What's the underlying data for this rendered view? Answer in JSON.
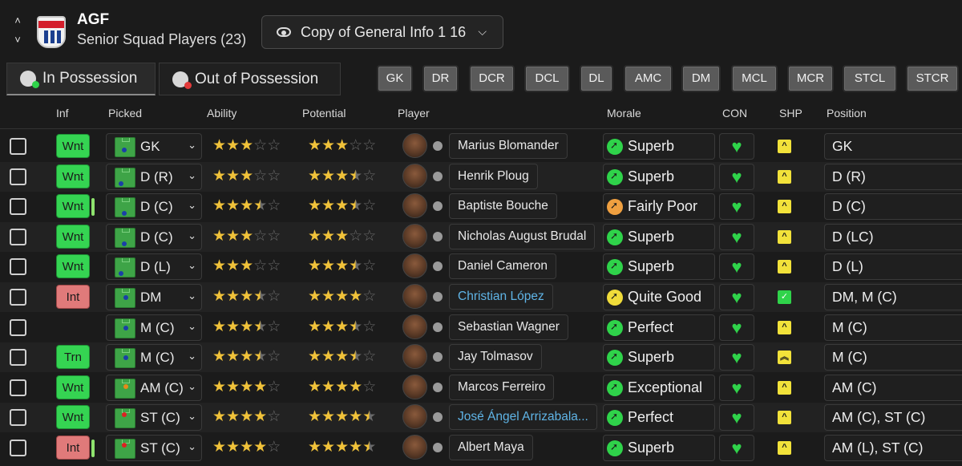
{
  "header": {
    "club": "AGF",
    "squad_title": "Senior Squad Players (23)",
    "view_selector": "Copy of General Info 1 16"
  },
  "tabs": [
    {
      "label": "In Possession",
      "icon": "possession-ball-icon",
      "active": true
    },
    {
      "label": "Out of Possession",
      "icon": "out-of-possession-ball-icon",
      "active": false
    }
  ],
  "position_filters": [
    "GK",
    "DR",
    "DCR",
    "DCL",
    "DL",
    "AMC",
    "DM",
    "MCL",
    "MCR",
    "STCL",
    "STCR"
  ],
  "columns": {
    "inf": "Inf",
    "picked": "Picked",
    "ability": "Ability",
    "potential": "Potential",
    "player": "Player",
    "morale": "Morale",
    "con": "CON",
    "shp": "SHP",
    "position": "Position"
  },
  "colors": {
    "wanted": "#35d452",
    "interested": "#e07a7a",
    "star": "#f0c23a",
    "morale_good": "#2fd34a",
    "morale_poor": "#f0a040",
    "morale_ok": "#f0dc3a",
    "sharpness": "#f2e23a"
  },
  "rows": [
    {
      "inf": "Wnt",
      "picked": "GK",
      "ability": 3,
      "potential": 3,
      "player": "Marius Blomander",
      "morale": "Superb",
      "morale_level": "good",
      "position": "GK",
      "shp": "arrow-up"
    },
    {
      "inf": "Wnt",
      "picked": "D (R)",
      "ability": 3,
      "potential": 3.5,
      "player": "Henrik Ploug",
      "morale": "Superb",
      "morale_level": "good",
      "position": "D (R)",
      "shp": "arrow-up"
    },
    {
      "inf": "Wnt",
      "picked": "D (C)",
      "ability": 3.5,
      "potential": 3.5,
      "player": "Baptiste Bouche",
      "morale": "Fairly Poor",
      "morale_level": "poor",
      "position": "D (C)",
      "shp": "arrow-up"
    },
    {
      "inf": "Wnt",
      "picked": "D (C)",
      "ability": 3,
      "potential": 3,
      "player": "Nicholas August Brudal",
      "morale": "Superb",
      "morale_level": "good",
      "position": "D (LC)",
      "shp": "arrow-up"
    },
    {
      "inf": "Wnt",
      "picked": "D (L)",
      "ability": 3,
      "potential": 3.5,
      "player": "Daniel Cameron",
      "morale": "Superb",
      "morale_level": "good",
      "position": "D (L)",
      "shp": "arrow-up"
    },
    {
      "inf": "Int",
      "picked": "DM",
      "ability": 3.5,
      "potential": 4,
      "player": "Christian López",
      "morale": "Quite Good",
      "morale_level": "ok",
      "position": "DM, M (C)",
      "shp": "check"
    },
    {
      "inf": "",
      "picked": "M (C)",
      "ability": 3.5,
      "potential": 3.5,
      "player": "Sebastian Wagner",
      "morale": "Perfect",
      "morale_level": "good",
      "position": "M (C)",
      "shp": "arrow-up"
    },
    {
      "inf": "Trn",
      "picked": "M (C)",
      "ability": 3.5,
      "potential": 3.5,
      "player": "Jay Tolmasov",
      "morale": "Superb",
      "morale_level": "good",
      "position": "M (C)",
      "shp": "double-arrow-up"
    },
    {
      "inf": "Wnt",
      "picked": "AM (C)",
      "ability": 4,
      "potential": 4,
      "player": "Marcos Ferreiro",
      "morale": "Exceptional",
      "morale_level": "good",
      "position": "AM (C)",
      "shp": "arrow-up"
    },
    {
      "inf": "Wnt",
      "picked": "ST (C)",
      "ability": 4,
      "potential": 4.5,
      "player": "José Ángel Arrizabala...",
      "morale": "Perfect",
      "morale_level": "good",
      "position": "AM (C), ST (C)",
      "shp": "arrow-up"
    },
    {
      "inf": "Int",
      "picked": "ST (C)",
      "ability": 4,
      "potential": 4.5,
      "player": "Albert Maya",
      "morale": "Superb",
      "morale_level": "good",
      "position": "AM (L), ST (C)",
      "shp": "arrow-up"
    }
  ]
}
